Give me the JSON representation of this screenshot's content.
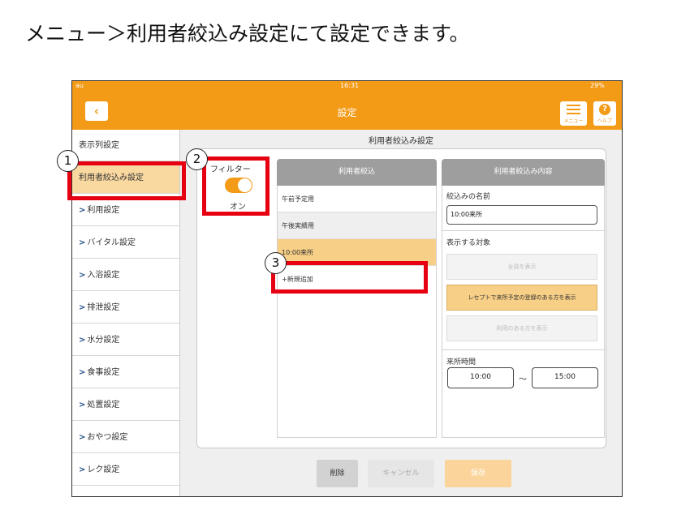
{
  "heading": "メニュー＞利用者絞込み設定にて設定できます。",
  "status_bar": {
    "carrier": "au",
    "time": "16:31",
    "battery": "29%"
  },
  "nav": {
    "back_icon": "chevron-left-icon",
    "title": "設定",
    "menu_label": "メニュー",
    "help_label": "ヘルプ",
    "help_glyph": "?"
  },
  "sidebar": {
    "items": [
      {
        "label": "表示列設定",
        "chevron": ""
      },
      {
        "label": "利用者絞込み設定",
        "chevron": ""
      },
      {
        "label": "利用設定",
        "chevron": ">"
      },
      {
        "label": "バイタル設定",
        "chevron": ">"
      },
      {
        "label": "入浴設定",
        "chevron": ">"
      },
      {
        "label": "排泄設定",
        "chevron": ">"
      },
      {
        "label": "水分設定",
        "chevron": ">"
      },
      {
        "label": "食事設定",
        "chevron": ">"
      },
      {
        "label": "処置設定",
        "chevron": ">"
      },
      {
        "label": "おやつ設定",
        "chevron": ">"
      },
      {
        "label": "レク設定",
        "chevron": ">"
      }
    ]
  },
  "main": {
    "title": "利用者絞込み設定",
    "filter": {
      "label": "フィルター",
      "state": "オン",
      "enabled": true
    },
    "list": {
      "header": "利用者絞込",
      "items": [
        "午前予定用",
        "午後実績用",
        "10:00来所",
        "+新規追加"
      ]
    },
    "detail": {
      "header": "利用者絞込み内容",
      "name_label": "絞込みの名前",
      "name_value": "10:00来所",
      "target_label": "表示する対象",
      "options": [
        "全員を表示",
        "レセプトで来所予定の登録のある方を表示",
        "利用のある方を表示"
      ],
      "time_label": "来所時間",
      "time_from": "10:00",
      "time_sep": "～",
      "time_to": "15:00"
    },
    "buttons": {
      "delete": "削除",
      "cancel": "キャンセル",
      "save": "保存"
    }
  },
  "callouts": [
    "1",
    "2",
    "3"
  ],
  "colors": {
    "accent": "#f39a16",
    "selected": "#f7cf86",
    "callout": "#e60012"
  }
}
